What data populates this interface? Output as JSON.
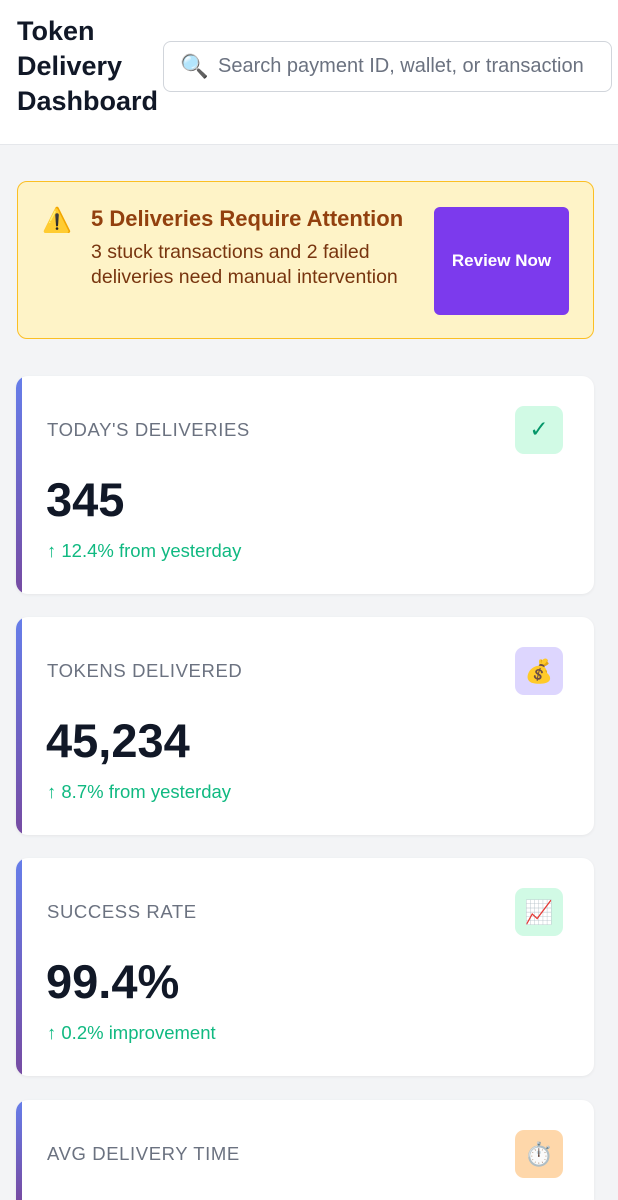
{
  "header": {
    "title": "Token Delivery Dashboard",
    "search_placeholder": "Search payment ID, wallet, or transaction",
    "search_value": "",
    "search_icon": "🔍"
  },
  "alert": {
    "icon": "⚠️",
    "title": "5 Deliveries Require Attention",
    "message": "3 stuck transactions and 2 failed deliveries need manual intervention",
    "button_label": "Review Now"
  },
  "stats": [
    {
      "label": "TODAY'S DELIVERIES",
      "value": "345",
      "change": "↑  12.4% from yesterday",
      "icon": "✓",
      "icon_name": "check-icon",
      "icon_bg": "#d1fae5",
      "icon_color": "#059669"
    },
    {
      "label": "TOKENS DELIVERED",
      "value": "45,234",
      "change": "↑  8.7% from yesterday",
      "icon": "💰",
      "icon_name": "money-bag-icon",
      "icon_bg": "#ddd6fe",
      "icon_color": "#b45309"
    },
    {
      "label": "SUCCESS RATE",
      "value": "99.4%",
      "change": "↑  0.2% improvement",
      "icon": "📈",
      "icon_name": "chart-up-icon",
      "icon_bg": "#d1fae5",
      "icon_color": "#dc2626"
    },
    {
      "label": "AVG DELIVERY TIME",
      "value": "",
      "change": "",
      "icon": "⏱️",
      "icon_name": "stopwatch-icon",
      "icon_bg": "#fed7aa",
      "icon_color": "#374151"
    }
  ],
  "colors": {
    "accent": "#7c3aed",
    "alert_bg": "#fef3c7",
    "alert_border": "#fbbf24",
    "positive": "#10b981",
    "card_gradient_top": "#667eea",
    "card_gradient_bottom": "#764ba2"
  }
}
